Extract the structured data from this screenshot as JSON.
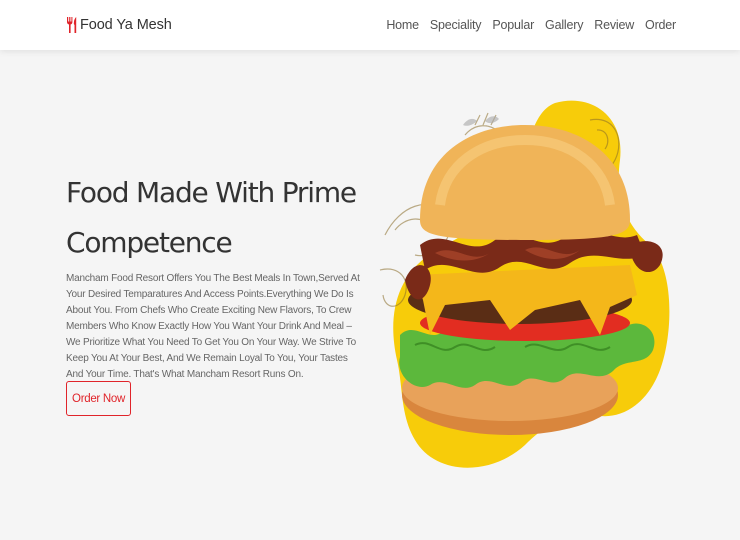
{
  "header": {
    "logo_text": "Food Ya Mesh",
    "logo_icon": "utensils-icon",
    "nav": [
      {
        "label": "Home"
      },
      {
        "label": "Speciality"
      },
      {
        "label": "Popular"
      },
      {
        "label": "Gallery"
      },
      {
        "label": "Review"
      },
      {
        "label": "Order"
      }
    ]
  },
  "hero": {
    "title": "Food Made With Prime Competence",
    "description": "Mancham Food Resort Offers You The Best Meals In Town,Served At Your Desired Temparatures And Access Points.Everything We Do Is About You. From Chefs Who Create Exciting New Flavors, To Crew Members Who Know Exactly How You Want Your Drink And Meal – We Prioritize What You Need To Get You On Your Way. We Strive To Keep You At Your Best, And We Remain Loyal To You, Your Tastes And Your Time. That's What Mancham Resort Runs On.",
    "button_label": "Order Now",
    "image": "burger-image"
  },
  "colors": {
    "accent": "#e0242a",
    "blob": "#f7cc0a",
    "background": "#f5f5f5"
  }
}
